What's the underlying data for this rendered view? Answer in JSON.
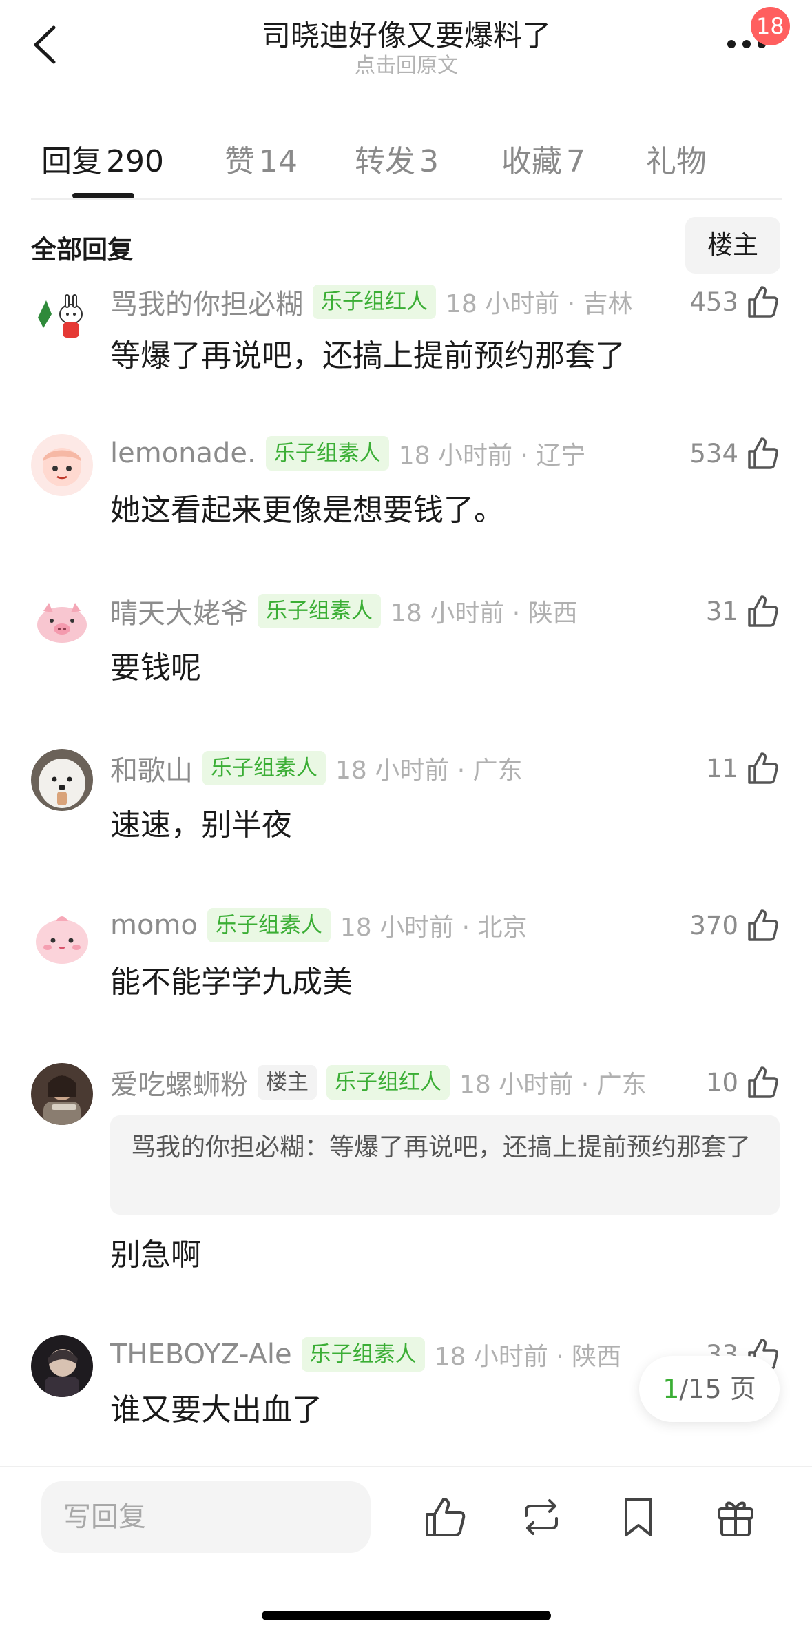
{
  "header": {
    "title": "司晓迪好像又要爆料了",
    "subtitle": "点击回原文",
    "notification_count": "18"
  },
  "tabs": [
    {
      "label": "回复",
      "count": "290",
      "active": true
    },
    {
      "label": "赞",
      "count": "14"
    },
    {
      "label": "转发",
      "count": "3"
    },
    {
      "label": "收藏",
      "count": "7"
    },
    {
      "label": "礼物",
      "count": ""
    }
  ],
  "filter": {
    "all_label": "全部回复",
    "op_label": "楼主"
  },
  "comments": [
    {
      "username": "骂我的你担必糊",
      "tag": "乐子组红人",
      "time_loc": "18 小时前 · 吉林",
      "likes": "453",
      "text": "等爆了再说吧，还搞上提前预约那套了"
    },
    {
      "username": "lemonade.",
      "tag": "乐子组素人",
      "time_loc": "18 小时前 · 辽宁",
      "likes": "534",
      "text": "她这看起来更像是想要钱了。"
    },
    {
      "username": "晴天大姥爷",
      "tag": "乐子组素人",
      "time_loc": "18 小时前 · 陕西",
      "likes": "31",
      "text": "要钱呢"
    },
    {
      "username": "和歌山",
      "tag": "乐子组素人",
      "time_loc": "18 小时前 · 广东",
      "likes": "11",
      "text": "速速，别半夜"
    },
    {
      "username": "momo",
      "tag": "乐子组素人",
      "time_loc": "18 小时前 · 北京",
      "likes": "370",
      "text": "能不能学学九成美"
    },
    {
      "username": "爱吃螺蛳粉",
      "op_tag": "楼主",
      "tag": "乐子组红人",
      "time_loc": "18 小时前 · 广东",
      "likes": "10",
      "quote": "骂我的你担必糊：等爆了再说吧，还搞上提前预约那套了",
      "text": "别急啊"
    },
    {
      "username": "THEBOYZ-Ale",
      "tag": "乐子组素人",
      "time_loc": "18 小时前 · 陕西",
      "likes": "33",
      "text": "谁又要大出血了"
    }
  ],
  "pagination": {
    "current": "1",
    "total": "/15 页"
  },
  "bottom_bar": {
    "reply_placeholder": "写回复"
  },
  "colors": {
    "accent_green": "#3bae35",
    "tag_bg_green": "#eaf8e4",
    "badge_red": "#ff5f5f"
  }
}
